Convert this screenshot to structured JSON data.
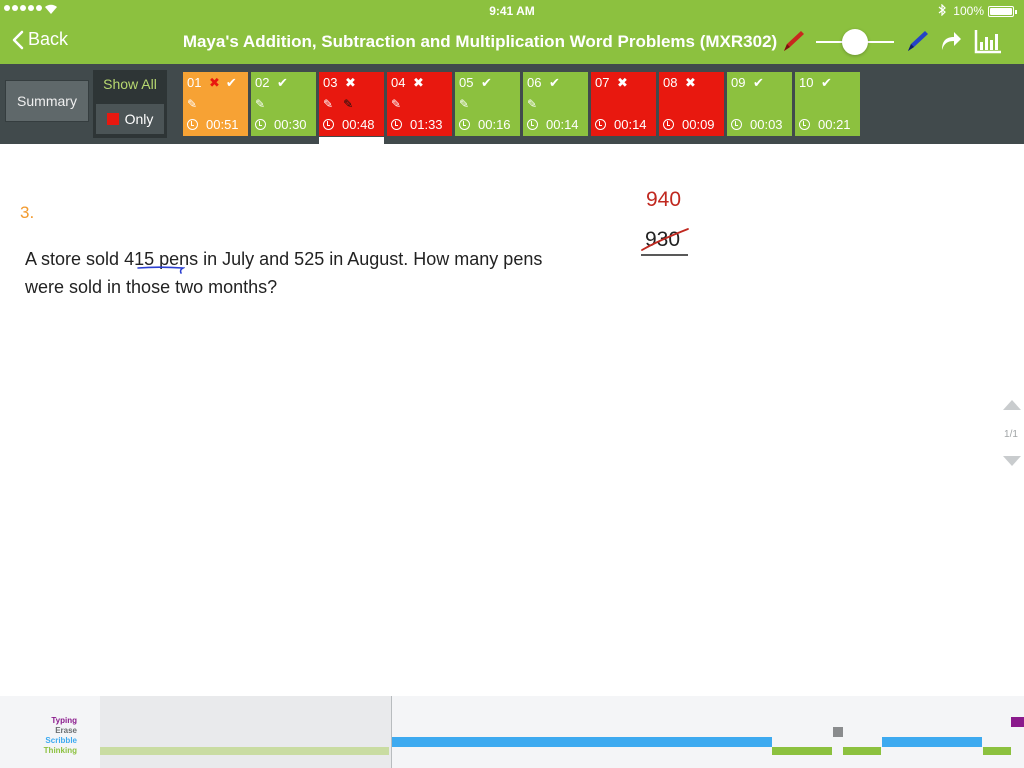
{
  "status_bar": {
    "time": "9:41 AM",
    "battery": "100%"
  },
  "nav": {
    "back_label": "Back",
    "title": "Maya's Addition, Subtraction and Multiplication Word Problems (MXR302)"
  },
  "sidebar": {
    "summary_label": "Summary",
    "show_all_label": "Show All",
    "only_label": "Only"
  },
  "questions": [
    {
      "num": "01",
      "time": "00:51",
      "status": "partial",
      "color": "#f7a234"
    },
    {
      "num": "02",
      "time": "00:30",
      "status": "correct",
      "color": "#8cc13f"
    },
    {
      "num": "03",
      "time": "00:48",
      "status": "incorrect",
      "color": "#e8180f"
    },
    {
      "num": "04",
      "time": "01:33",
      "status": "incorrect",
      "color": "#e8180f"
    },
    {
      "num": "05",
      "time": "00:16",
      "status": "correct",
      "color": "#8cc13f"
    },
    {
      "num": "06",
      "time": "00:14",
      "status": "correct",
      "color": "#8cc13f"
    },
    {
      "num": "07",
      "time": "00:14",
      "status": "incorrect",
      "color": "#e8180f"
    },
    {
      "num": "08",
      "time": "00:09",
      "status": "incorrect",
      "color": "#e8180f"
    },
    {
      "num": "09",
      "time": "00:03",
      "status": "correct",
      "color": "#8cc13f"
    },
    {
      "num": "10",
      "time": "00:21",
      "status": "correct",
      "color": "#8cc13f"
    }
  ],
  "question": {
    "number": "3.",
    "text_before": "A store sold ",
    "highlight": "415 p",
    "text_after": "ens in July and 525 in August. How many pens were sold in those two months?",
    "answer_corrected": "940",
    "answer_original": "930"
  },
  "pager": {
    "label": "1/1"
  },
  "timeline": {
    "legend": {
      "typing": "Typing",
      "erase": "Erase",
      "scribble": "Scribble",
      "thinking": "Thinking"
    },
    "colors": {
      "typing": "#8a1a8c",
      "erase": "#8a8c8e",
      "scribble": "#3daaf0",
      "thinking": "#8cc13f"
    }
  },
  "colors": {
    "accent": "#8cc13f",
    "toolbar": "#414a4c",
    "incorrect": "#e8180f",
    "partial": "#f7a234",
    "question_number": "#f29a2e"
  }
}
